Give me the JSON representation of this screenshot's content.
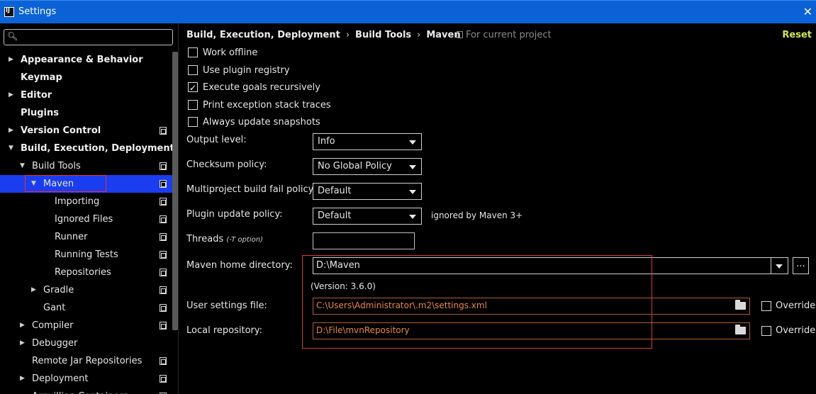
{
  "window": {
    "title": "Settings",
    "app_icon": "intellij-icon",
    "close_icon": "close-icon"
  },
  "sidebar": {
    "search": {
      "value": "",
      "placeholder": "",
      "icon": "search-icon"
    },
    "items": [
      {
        "label": "Appearance & Behavior",
        "bold": true,
        "arrow": "▶",
        "has_copy": false
      },
      {
        "label": "Keymap",
        "bold": true,
        "arrow": "",
        "has_copy": false
      },
      {
        "label": "Editor",
        "bold": true,
        "arrow": "▶",
        "has_copy": false
      },
      {
        "label": "Plugins",
        "bold": true,
        "arrow": "",
        "has_copy": false
      },
      {
        "label": "Version Control",
        "bold": true,
        "arrow": "▶",
        "has_copy": true
      },
      {
        "label": "Build, Execution, Deployment",
        "bold": true,
        "arrow": "▼",
        "has_copy": false
      },
      {
        "label": "Build Tools",
        "bold": false,
        "arrow": "▼",
        "has_copy": true
      },
      {
        "label": "Maven",
        "bold": false,
        "arrow": "▼",
        "has_copy": true,
        "selected": true
      },
      {
        "label": "Importing",
        "bold": false,
        "arrow": "",
        "has_copy": true
      },
      {
        "label": "Ignored Files",
        "bold": false,
        "arrow": "",
        "has_copy": true
      },
      {
        "label": "Runner",
        "bold": false,
        "arrow": "",
        "has_copy": true
      },
      {
        "label": "Running Tests",
        "bold": false,
        "arrow": "",
        "has_copy": true
      },
      {
        "label": "Repositories",
        "bold": false,
        "arrow": "",
        "has_copy": true
      },
      {
        "label": "Gradle",
        "bold": false,
        "arrow": "▶",
        "has_copy": true
      },
      {
        "label": "Gant",
        "bold": false,
        "arrow": "",
        "has_copy": true
      },
      {
        "label": "Compiler",
        "bold": false,
        "arrow": "▶",
        "has_copy": true
      },
      {
        "label": "Debugger",
        "bold": false,
        "arrow": "▶",
        "has_copy": false
      },
      {
        "label": "Remote Jar Repositories",
        "bold": false,
        "arrow": "",
        "has_copy": true
      },
      {
        "label": "Deployment",
        "bold": false,
        "arrow": "▶",
        "has_copy": true
      },
      {
        "label": "Arquillian Containers",
        "bold": false,
        "arrow": "",
        "has_copy": true
      }
    ]
  },
  "header": {
    "breadcrumb": [
      "Build, Execution, Deployment",
      "Build Tools",
      "Maven"
    ],
    "breadcrumb_separator": "›",
    "scope": "For current project",
    "reset": "Reset"
  },
  "options": [
    {
      "label": "Work offline",
      "checked": false
    },
    {
      "label": "Use plugin registry",
      "checked": false
    },
    {
      "label": "Execute goals recursively",
      "checked": true
    },
    {
      "label": "Print exception stack traces",
      "checked": false
    },
    {
      "label": "Always update snapshots",
      "checked": false
    }
  ],
  "fields": {
    "output_level": {
      "label": "Output level:",
      "value": "Info"
    },
    "checksum_policy": {
      "label": "Checksum policy:",
      "value": "No Global Policy"
    },
    "multiproject_fail_policy": {
      "label": "Multiproject build fail policy:",
      "value": "Default"
    },
    "plugin_update_policy": {
      "label": "Plugin update policy:",
      "value": "Default",
      "hint": "ignored by Maven 3+"
    },
    "threads": {
      "label": "Threads",
      "note": "(-T option)",
      "value": ""
    },
    "maven_home": {
      "label": "Maven home directory:",
      "value": "D:\\Maven",
      "browse": "...",
      "version": "(Version: 3.6.0)"
    },
    "user_settings": {
      "label": "User settings file:",
      "value": "C:\\Users\\Administrator\\.m2\\settings.xml",
      "override": "Override",
      "override_checked": false
    },
    "local_repository": {
      "label": "Local repository:",
      "value": "D:\\File\\mvnRepository",
      "override": "Override",
      "override_checked": false
    }
  },
  "colors": {
    "titlebar": "#0a62d6",
    "selection": "#1a3df0",
    "reset": "#d5e84a",
    "path_text": "#e8883a",
    "highlight": "#d63a3a"
  }
}
